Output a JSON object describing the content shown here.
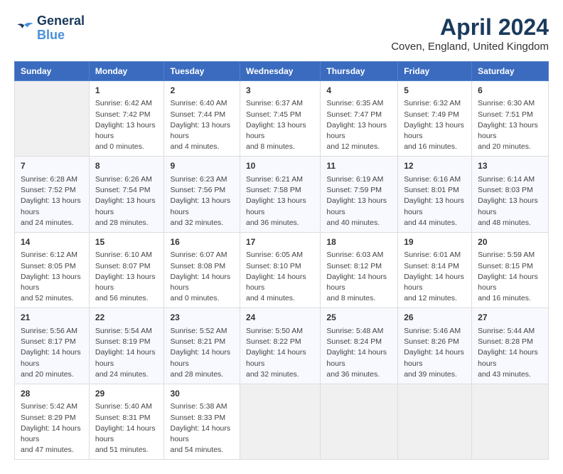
{
  "header": {
    "logo_line1": "General",
    "logo_line2": "Blue",
    "month": "April 2024",
    "location": "Coven, England, United Kingdom"
  },
  "days_of_week": [
    "Sunday",
    "Monday",
    "Tuesday",
    "Wednesday",
    "Thursday",
    "Friday",
    "Saturday"
  ],
  "weeks": [
    [
      {
        "day": "",
        "empty": true
      },
      {
        "day": "1",
        "sunrise": "6:42 AM",
        "sunset": "7:42 PM",
        "daylight": "13 hours and 0 minutes."
      },
      {
        "day": "2",
        "sunrise": "6:40 AM",
        "sunset": "7:44 PM",
        "daylight": "13 hours and 4 minutes."
      },
      {
        "day": "3",
        "sunrise": "6:37 AM",
        "sunset": "7:45 PM",
        "daylight": "13 hours and 8 minutes."
      },
      {
        "day": "4",
        "sunrise": "6:35 AM",
        "sunset": "7:47 PM",
        "daylight": "13 hours and 12 minutes."
      },
      {
        "day": "5",
        "sunrise": "6:32 AM",
        "sunset": "7:49 PM",
        "daylight": "13 hours and 16 minutes."
      },
      {
        "day": "6",
        "sunrise": "6:30 AM",
        "sunset": "7:51 PM",
        "daylight": "13 hours and 20 minutes."
      }
    ],
    [
      {
        "day": "7",
        "sunrise": "6:28 AM",
        "sunset": "7:52 PM",
        "daylight": "13 hours and 24 minutes."
      },
      {
        "day": "8",
        "sunrise": "6:26 AM",
        "sunset": "7:54 PM",
        "daylight": "13 hours and 28 minutes."
      },
      {
        "day": "9",
        "sunrise": "6:23 AM",
        "sunset": "7:56 PM",
        "daylight": "13 hours and 32 minutes."
      },
      {
        "day": "10",
        "sunrise": "6:21 AM",
        "sunset": "7:58 PM",
        "daylight": "13 hours and 36 minutes."
      },
      {
        "day": "11",
        "sunrise": "6:19 AM",
        "sunset": "7:59 PM",
        "daylight": "13 hours and 40 minutes."
      },
      {
        "day": "12",
        "sunrise": "6:16 AM",
        "sunset": "8:01 PM",
        "daylight": "13 hours and 44 minutes."
      },
      {
        "day": "13",
        "sunrise": "6:14 AM",
        "sunset": "8:03 PM",
        "daylight": "13 hours and 48 minutes."
      }
    ],
    [
      {
        "day": "14",
        "sunrise": "6:12 AM",
        "sunset": "8:05 PM",
        "daylight": "13 hours and 52 minutes."
      },
      {
        "day": "15",
        "sunrise": "6:10 AM",
        "sunset": "8:07 PM",
        "daylight": "13 hours and 56 minutes."
      },
      {
        "day": "16",
        "sunrise": "6:07 AM",
        "sunset": "8:08 PM",
        "daylight": "14 hours and 0 minutes."
      },
      {
        "day": "17",
        "sunrise": "6:05 AM",
        "sunset": "8:10 PM",
        "daylight": "14 hours and 4 minutes."
      },
      {
        "day": "18",
        "sunrise": "6:03 AM",
        "sunset": "8:12 PM",
        "daylight": "14 hours and 8 minutes."
      },
      {
        "day": "19",
        "sunrise": "6:01 AM",
        "sunset": "8:14 PM",
        "daylight": "14 hours and 12 minutes."
      },
      {
        "day": "20",
        "sunrise": "5:59 AM",
        "sunset": "8:15 PM",
        "daylight": "14 hours and 16 minutes."
      }
    ],
    [
      {
        "day": "21",
        "sunrise": "5:56 AM",
        "sunset": "8:17 PM",
        "daylight": "14 hours and 20 minutes."
      },
      {
        "day": "22",
        "sunrise": "5:54 AM",
        "sunset": "8:19 PM",
        "daylight": "14 hours and 24 minutes."
      },
      {
        "day": "23",
        "sunrise": "5:52 AM",
        "sunset": "8:21 PM",
        "daylight": "14 hours and 28 minutes."
      },
      {
        "day": "24",
        "sunrise": "5:50 AM",
        "sunset": "8:22 PM",
        "daylight": "14 hours and 32 minutes."
      },
      {
        "day": "25",
        "sunrise": "5:48 AM",
        "sunset": "8:24 PM",
        "daylight": "14 hours and 36 minutes."
      },
      {
        "day": "26",
        "sunrise": "5:46 AM",
        "sunset": "8:26 PM",
        "daylight": "14 hours and 39 minutes."
      },
      {
        "day": "27",
        "sunrise": "5:44 AM",
        "sunset": "8:28 PM",
        "daylight": "14 hours and 43 minutes."
      }
    ],
    [
      {
        "day": "28",
        "sunrise": "5:42 AM",
        "sunset": "8:29 PM",
        "daylight": "14 hours and 47 minutes."
      },
      {
        "day": "29",
        "sunrise": "5:40 AM",
        "sunset": "8:31 PM",
        "daylight": "14 hours and 51 minutes."
      },
      {
        "day": "30",
        "sunrise": "5:38 AM",
        "sunset": "8:33 PM",
        "daylight": "14 hours and 54 minutes."
      },
      {
        "day": "",
        "empty": true
      },
      {
        "day": "",
        "empty": true
      },
      {
        "day": "",
        "empty": true
      },
      {
        "day": "",
        "empty": true
      }
    ]
  ],
  "labels": {
    "sunrise": "Sunrise:",
    "sunset": "Sunset:",
    "daylight": "Daylight:"
  }
}
